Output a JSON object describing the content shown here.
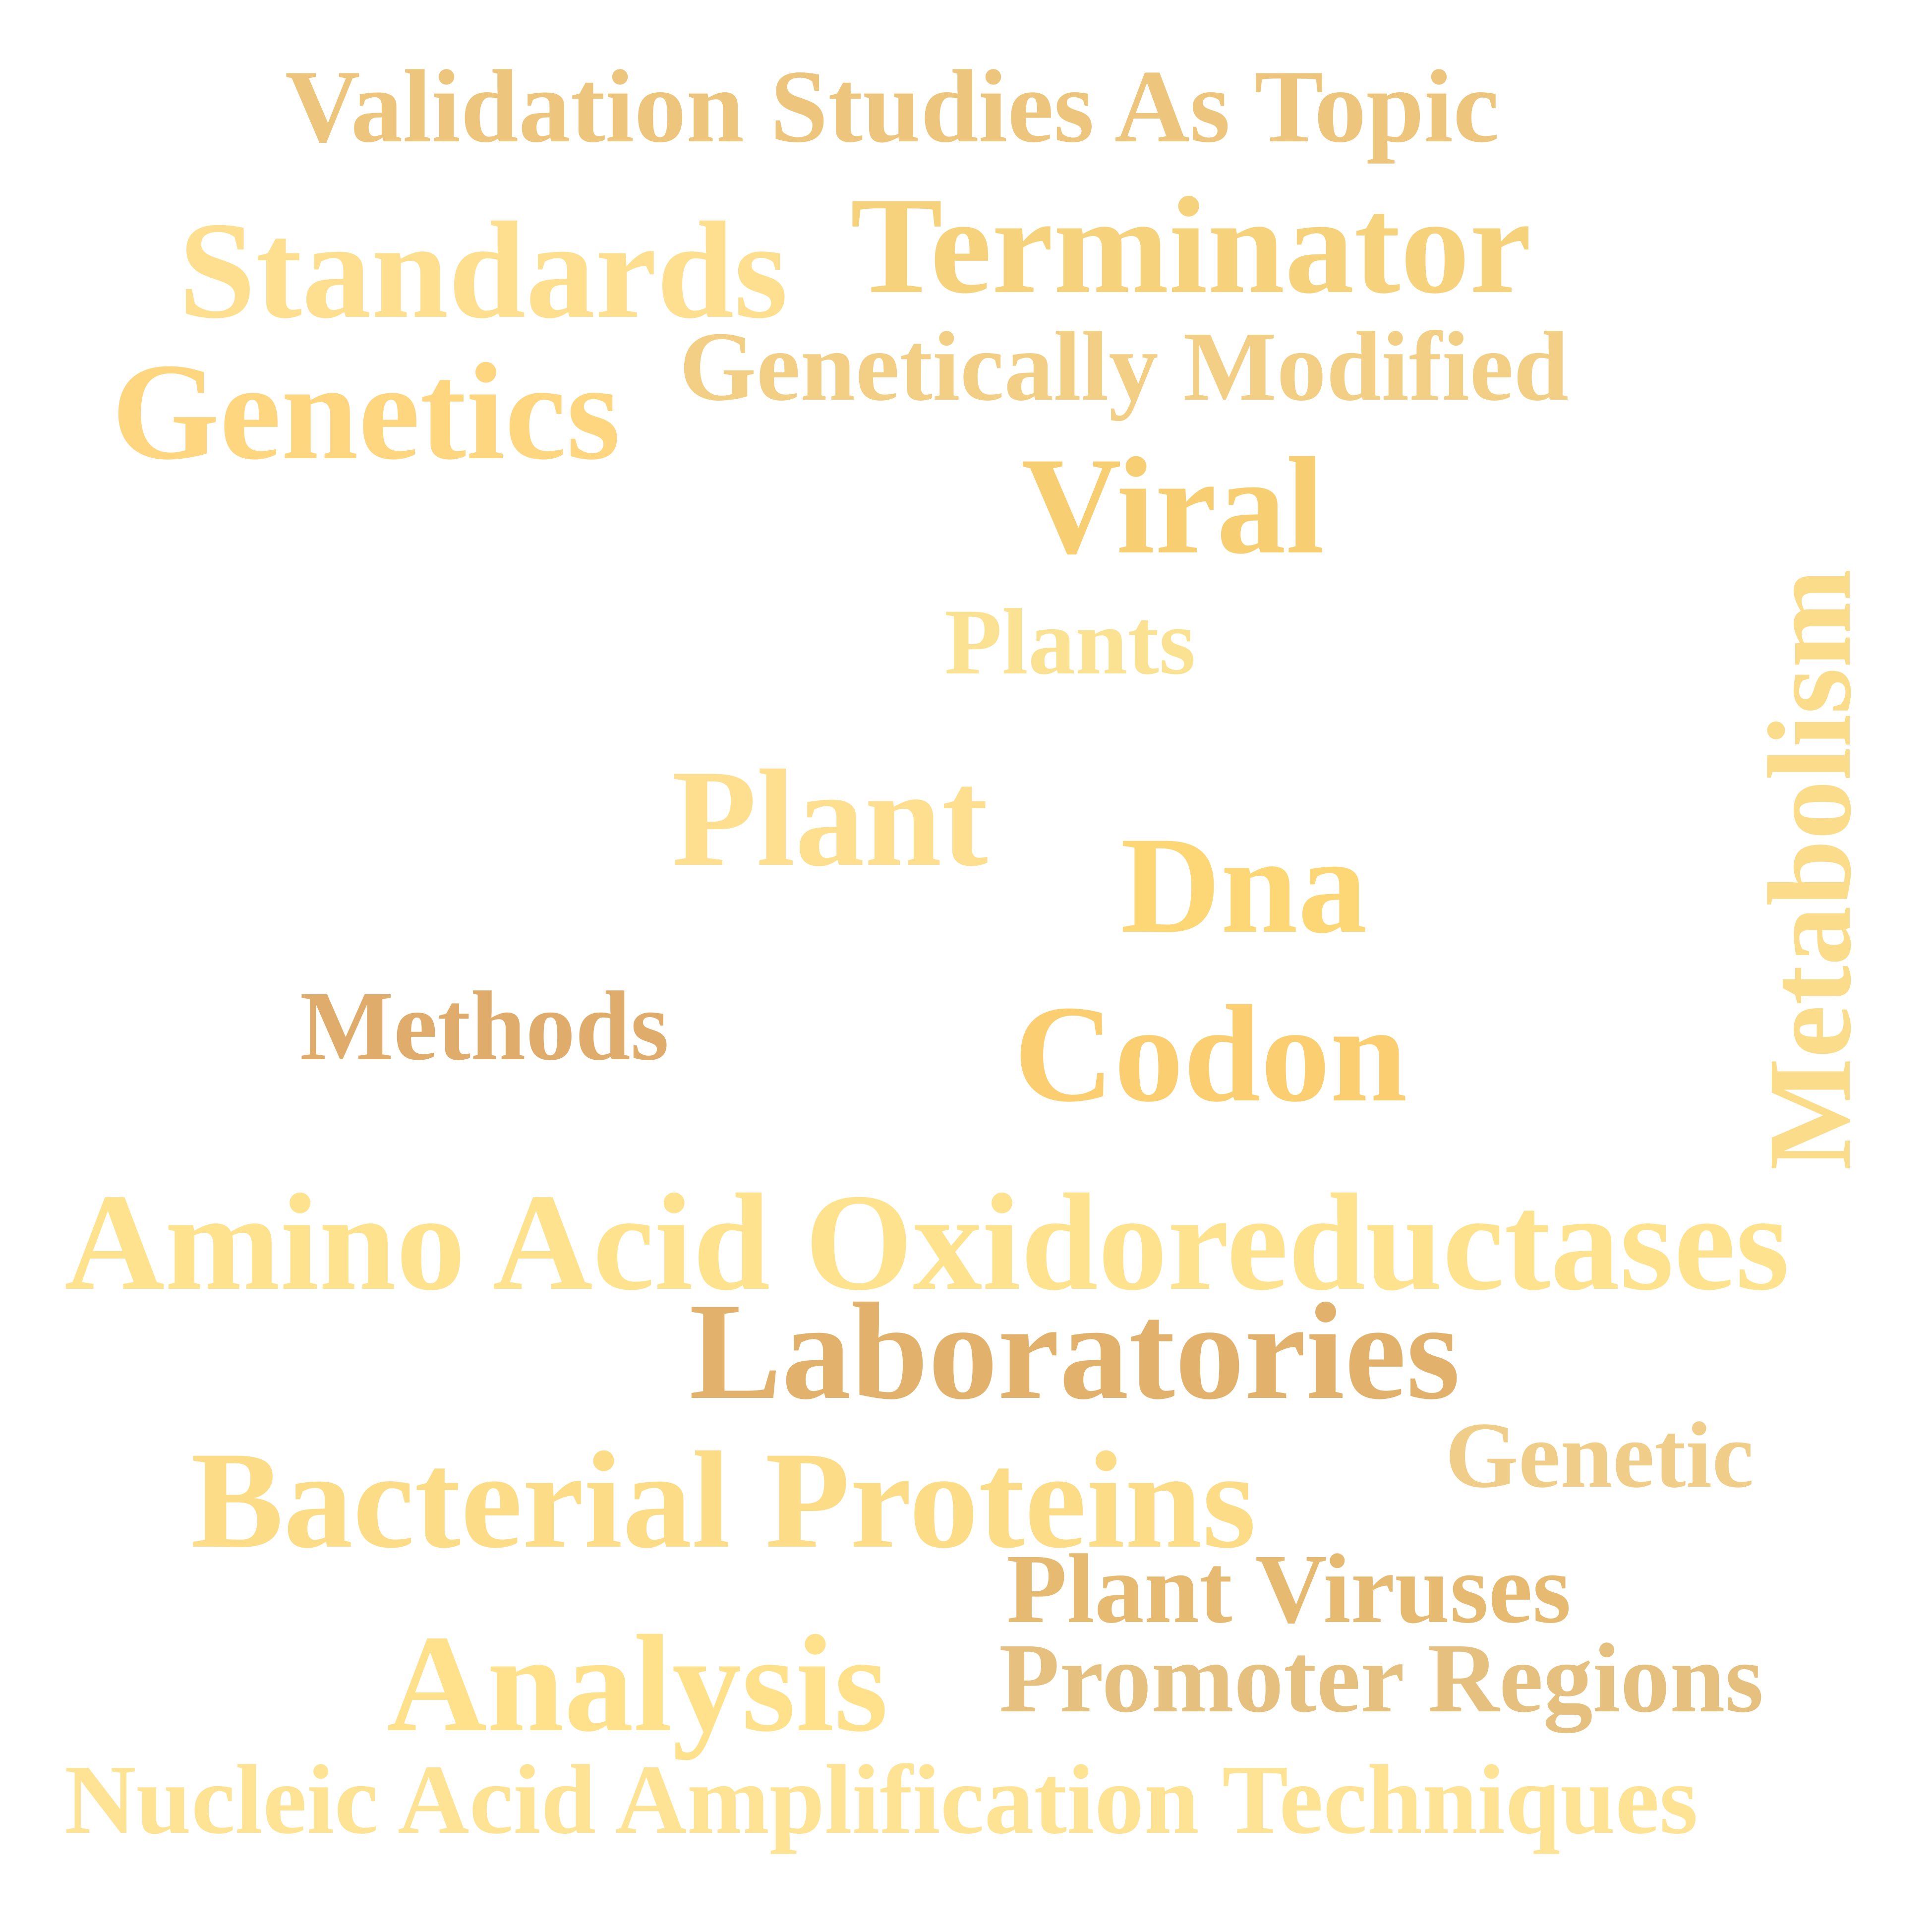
{
  "words": [
    {
      "id": "validation-studies-as-topic",
      "text": "Validation Studies As Topic",
      "color": "#edc57c"
    },
    {
      "id": "standards",
      "text": "Standards",
      "color": "#fedf8f"
    },
    {
      "id": "terminator",
      "text": "Terminator",
      "color": "#f6d27d"
    },
    {
      "id": "genetically-modified",
      "text": "Genetically Modified",
      "color": "#f2cf85"
    },
    {
      "id": "genetics",
      "text": "Genetics",
      "color": "#fdd67f"
    },
    {
      "id": "viral",
      "text": "Viral",
      "color": "#f7cf72"
    },
    {
      "id": "metabolism",
      "text": "Metabolism",
      "color": "#fbdc8b"
    },
    {
      "id": "plants",
      "text": "Plants",
      "color": "#fbe293"
    },
    {
      "id": "plant",
      "text": "Plant",
      "color": "#fddf8f"
    },
    {
      "id": "dna",
      "text": "Dna",
      "color": "#fdd675"
    },
    {
      "id": "methods",
      "text": "Methods",
      "color": "#dfac6c"
    },
    {
      "id": "codon",
      "text": "Codon",
      "color": "#fbcf71"
    },
    {
      "id": "amino-acid-oxidoreductases",
      "text": "Amino Acid Oxidoreductases",
      "color": "#fee28e"
    },
    {
      "id": "laboratories",
      "text": "Laboratories",
      "color": "#e2b26c"
    },
    {
      "id": "genetic",
      "text": "Genetic",
      "color": "#f0cd89"
    },
    {
      "id": "bacterial-proteins",
      "text": "Bacterial Proteins",
      "color": "#fddc87"
    },
    {
      "id": "plant-viruses",
      "text": "Plant Viruses",
      "color": "#e7ba72"
    },
    {
      "id": "analysis",
      "text": "Analysis",
      "color": "#ffe08b"
    },
    {
      "id": "promoter-regions",
      "text": "Promoter Regions",
      "color": "#e6c07f"
    },
    {
      "id": "nucleic-acid-amplification-techniques",
      "text": "Nucleic Acid Amplification Techniques",
      "color": "#fee394"
    }
  ]
}
